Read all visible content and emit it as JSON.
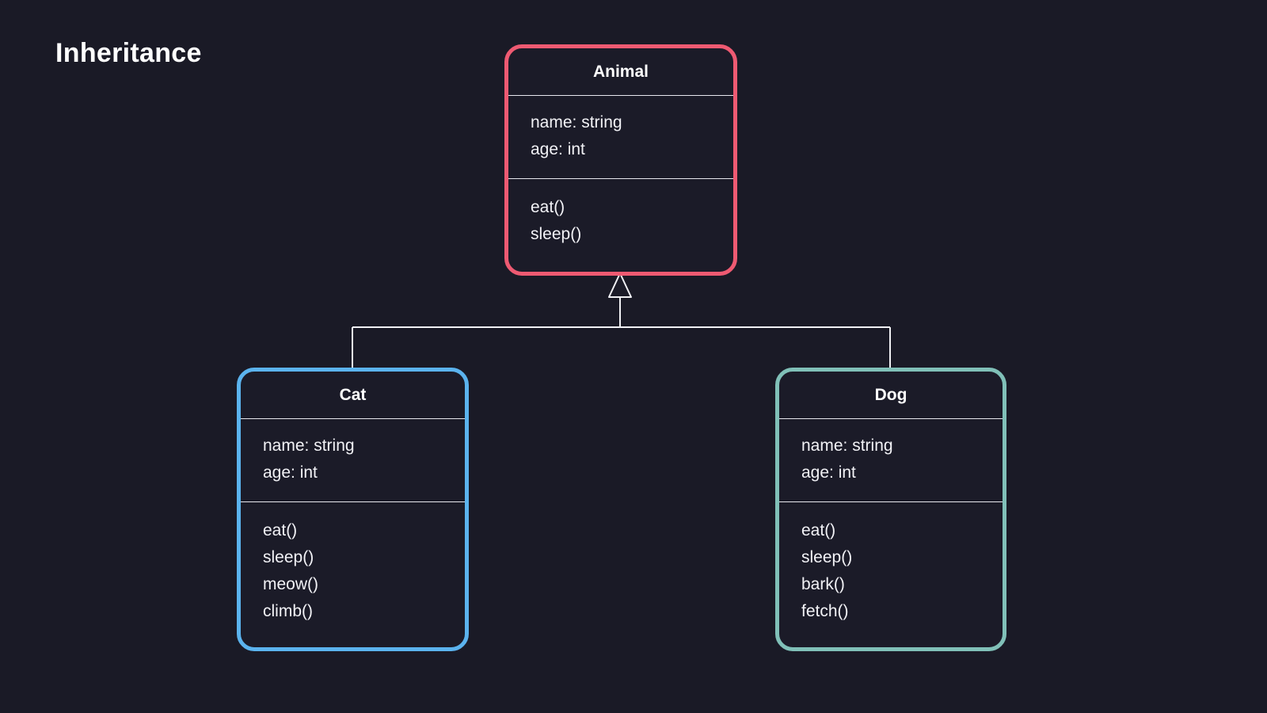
{
  "diagram": {
    "title": "Inheritance",
    "type": "uml-class-diagram",
    "background_color": "#1a1a26",
    "text_color": "#f2f2f6",
    "connector_color": "#f0f0f4",
    "relationship": "generalization"
  },
  "classes": {
    "animal": {
      "name": "Animal",
      "border_color": "#ee5a72",
      "attributes": [
        "name: string",
        "age: int"
      ],
      "methods": [
        "eat()",
        "sleep()"
      ]
    },
    "cat": {
      "name": "Cat",
      "border_color": "#5bb3ee",
      "attributes": [
        "name: string",
        "age: int"
      ],
      "methods": [
        "eat()",
        "sleep()",
        "meow()",
        "climb()"
      ]
    },
    "dog": {
      "name": "Dog",
      "border_color": "#80c0b8",
      "attributes": [
        "name: string",
        "age: int"
      ],
      "methods": [
        "eat()",
        "sleep()",
        "bark()",
        "fetch()"
      ]
    }
  }
}
